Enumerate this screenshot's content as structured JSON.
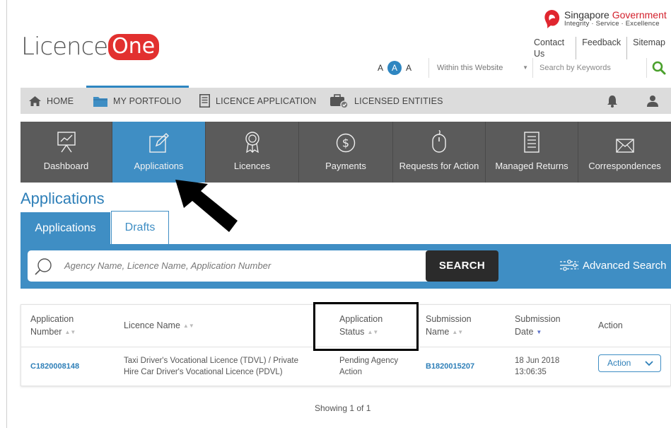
{
  "header": {
    "logo_text": "Licence",
    "logo_highlight": "One",
    "govt_name_1": "Singapore",
    "govt_name_2": "Government",
    "govt_tagline": "Integrity · Service · Excellence",
    "links": [
      "Contact Us",
      "Feedback",
      "Sitemap"
    ],
    "font_sizes": [
      "A",
      "A",
      "A"
    ],
    "search_scope": "Within this Website",
    "search_placeholder": "Search by Keywords"
  },
  "nav": {
    "items": [
      {
        "label": "HOME",
        "icon": "home-icon"
      },
      {
        "label": "MY PORTFOLIO",
        "icon": "folder-icon"
      },
      {
        "label": "LICENCE APPLICATION",
        "icon": "document-icon"
      },
      {
        "label": "LICENSED ENTITIES",
        "icon": "briefcase-icon"
      }
    ]
  },
  "tiles": [
    {
      "label": "Dashboard",
      "icon": "presentation-chart-icon"
    },
    {
      "label": "Applications",
      "icon": "edit-icon",
      "active": true
    },
    {
      "label": "Licences",
      "icon": "award-icon"
    },
    {
      "label": "Payments",
      "icon": "dollar-icon"
    },
    {
      "label": "Requests for Action",
      "icon": "mouse-icon"
    },
    {
      "label": "Managed Returns",
      "icon": "checklist-icon"
    },
    {
      "label": "Correspondences",
      "icon": "envelope-icon"
    }
  ],
  "page": {
    "title": "Applications",
    "tabs": [
      "Applications",
      "Drafts"
    ],
    "search_placeholder": "Agency Name, Licence Name, Application Number",
    "search_button": "SEARCH",
    "advanced_search": "Advanced Search"
  },
  "table": {
    "headers": {
      "app_number_1": "Application",
      "app_number_2": "Number",
      "licence_name": "Licence Name",
      "status_1": "Application",
      "status_2": "Status",
      "submission_name_1": "Submission",
      "submission_name_2": "Name",
      "submission_date_1": "Submission",
      "submission_date_2": "Date",
      "action": "Action"
    },
    "rows": [
      {
        "app_number": "C1820008148",
        "licence_name_1": "Taxi Driver's Vocational Licence (TDVL) / Private",
        "licence_name_2": "Hire Car Driver's Vocational Licence (PDVL)",
        "status_1": "Pending Agency",
        "status_2": "Action",
        "submission_name": "B1820015207",
        "date_1": "18 Jun 2018",
        "date_2": "13:06:35",
        "action_label": "Action"
      }
    ],
    "footer": "Showing 1 of 1"
  },
  "colors": {
    "accent": "#3f8ec4",
    "tiles_bg": "#5b5b5b",
    "brand_red": "#e2302f"
  }
}
